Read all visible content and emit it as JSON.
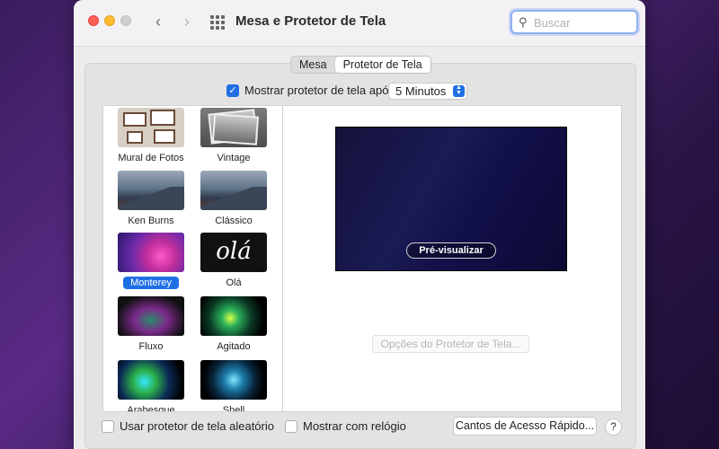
{
  "window": {
    "title": "Mesa e Protetor de Tela",
    "back_icon": "‹",
    "forward_icon": "›"
  },
  "search": {
    "placeholder": "Buscar",
    "value": ""
  },
  "tabs": [
    {
      "label": "Mesa",
      "selected": false
    },
    {
      "label": "Protetor de Tela",
      "selected": true
    }
  ],
  "show_after": {
    "label": "Mostrar protetor de tela após",
    "checked": true,
    "value": "5 Minutos"
  },
  "savers": [
    {
      "name": "Mural de Fotos",
      "selected": false
    },
    {
      "name": "Vintage",
      "selected": false
    },
    {
      "name": "Ken Burns",
      "selected": false
    },
    {
      "name": "Clássico",
      "selected": false
    },
    {
      "name": "Monterey",
      "selected": true
    },
    {
      "name": "Olá",
      "selected": false,
      "thumb_text": "olá"
    },
    {
      "name": "Fluxo",
      "selected": false
    },
    {
      "name": "Agitado",
      "selected": false
    },
    {
      "name": "Arabesque",
      "selected": false
    },
    {
      "name": "Shell",
      "selected": false
    }
  ],
  "preview": {
    "button_label": "Pré-visualizar"
  },
  "options_button": "Opções do Protetor de Tela...",
  "random": {
    "label": "Usar protetor de tela aleatório",
    "checked": false
  },
  "clock": {
    "label": "Mostrar com relógio",
    "checked": false
  },
  "hot_corners_button": "Cantos de Acesso Rápido...",
  "help_button": "?",
  "colors": {
    "accent": "#1f6fe5",
    "close": "#ff5f57",
    "minimize": "#febc2e"
  }
}
